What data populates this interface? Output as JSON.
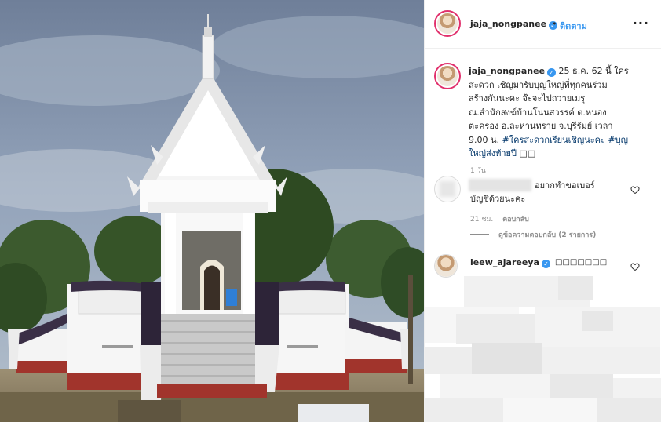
{
  "post": {
    "username": "jaja_nongpanee",
    "follow_label": "ติดตาม",
    "dot": "•",
    "more_label": "···",
    "verified_mark": "✓",
    "caption_line1": "25 ธ.ค. 62 นี้ ใคร",
    "caption_line2": "สะดวก เชิญมารับบุญใหญ่ที่ทุกคนร่วม",
    "caption_line3": "สร้างกันนะคะ จ๊ะจะไปถวายเมรุ",
    "caption_line4": "ณ.สำนักสงฆ์บ้านโนนสวรรค์ ต.หนอง",
    "caption_line5": "ตะครอง อ.ละหานทราย จ.บุรีรัมย์ เวลา",
    "caption_line6_pre": "9.00 น.",
    "caption_hashtag1": "#ใครสะดวกเรียนเชิญนะคะ",
    "caption_hashtag2": "#บุญ",
    "caption_hashtag2_cont": "ใหญ่ส่งท้ายปี",
    "caption_end": "□□",
    "time": "1 วัน"
  },
  "comments": [
    {
      "text_line1": "อยากทำขอเบอร์",
      "text_line2": "บัญชีด้วยนะคะ",
      "time": "21 ชม.",
      "reply_label": "ตอบกลับ",
      "view_replies": "ดูข้อความตอบกลับ (2 รายการ)"
    },
    {
      "username": "leew_ajareeya",
      "text": "□□□□□□□"
    }
  ],
  "colors": {
    "accent": "#3897f0",
    "ring": "#e1306c",
    "muted": "#8e8e8e"
  },
  "icons": [
    "verified-badge-icon",
    "heart-icon",
    "more-options-icon"
  ]
}
